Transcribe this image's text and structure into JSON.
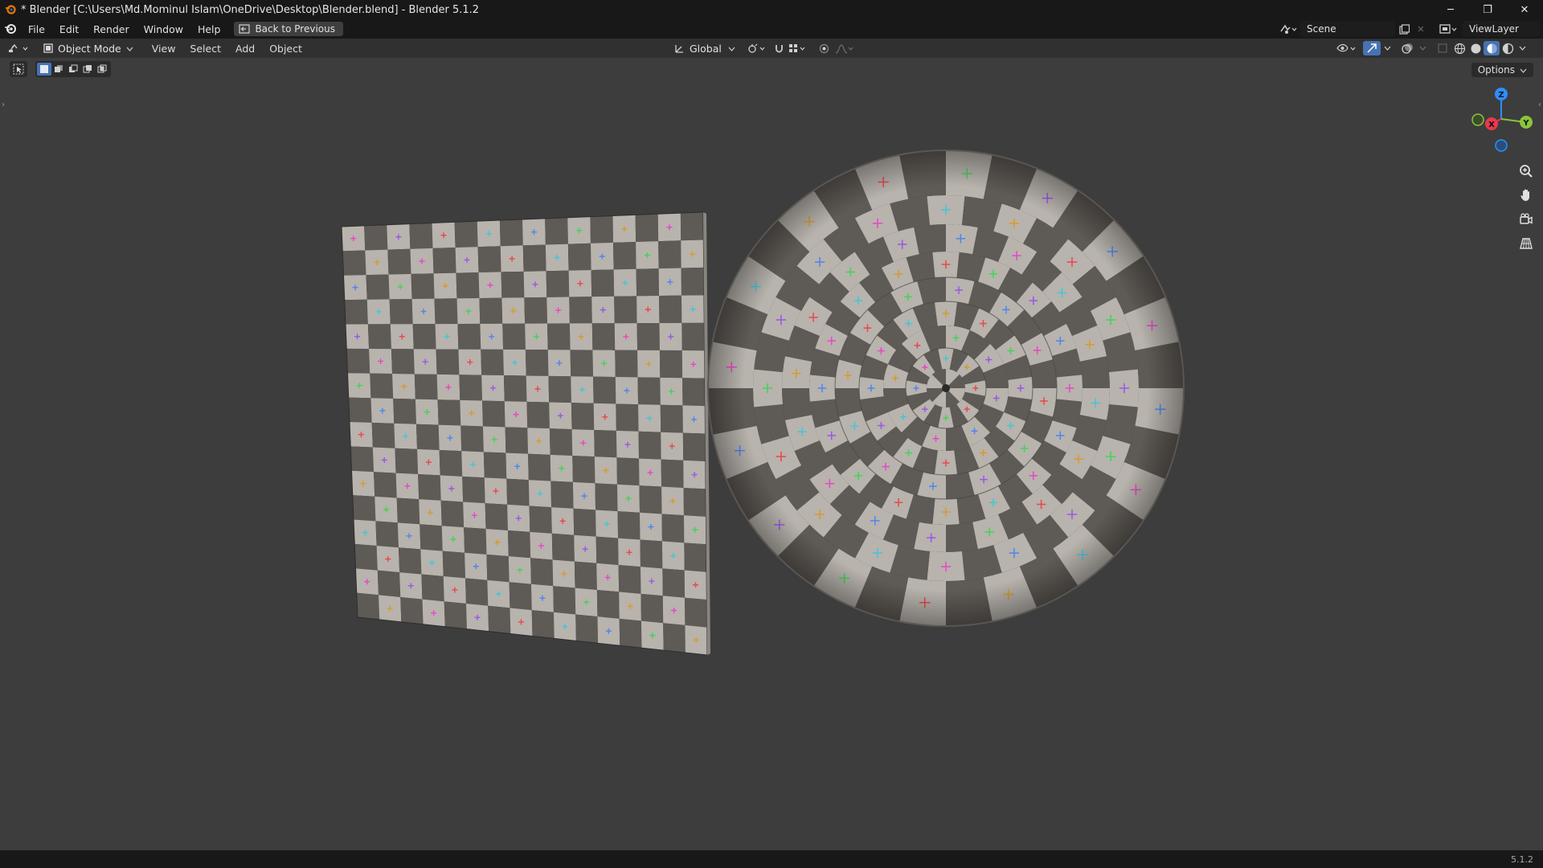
{
  "window": {
    "title": "* Blender [C:\\Users\\Md.Mominul Islam\\OneDrive\\Desktop\\Blender.blend] - Blender 5.1.2",
    "minimize": "─",
    "restore": "❐",
    "close": "✕"
  },
  "menubar": {
    "items": [
      "File",
      "Edit",
      "Render",
      "Window",
      "Help"
    ],
    "back_button": "Back to Previous",
    "scene_label": "Scene",
    "viewlayer_label": "ViewLayer"
  },
  "viewheader": {
    "mode": "Object Mode",
    "menus": [
      "View",
      "Select",
      "Add",
      "Object"
    ],
    "transform_orientation": "Global"
  },
  "toolbar": {
    "options_label": "Options"
  },
  "gizmo": {
    "z": "Z",
    "x": "X",
    "y": "Y",
    "colors": {
      "x": "#e8384f",
      "y": "#8bc33c",
      "z": "#2c8fff"
    }
  },
  "status": {
    "version": "5.1.2"
  },
  "icons": [
    "blender-logo-icon",
    "editor-type-icon",
    "object-mode-icon",
    "transform-orientation-icon",
    "pivot-icon",
    "snap-icon",
    "proportional-edit-icon",
    "visibility-icon",
    "gizmo-icon",
    "overlay-icon",
    "xray-icon",
    "wireframe-shading-icon",
    "solid-shading-icon",
    "material-shading-icon",
    "rendered-shading-icon",
    "zoom-icon",
    "pan-hand-icon",
    "camera-icon",
    "perspective-grid-icon",
    "select-box-icon"
  ],
  "viewport": {
    "background": "#3d3d3d",
    "checker_light": "#b8b3ad",
    "checker_dark": "#5e5a55",
    "marker_colors": [
      "#e845c8",
      "#d89a2a",
      "#3fd455",
      "#4a86f0",
      "#3fc7d8",
      "#e8474a",
      "#9a55e8"
    ]
  }
}
